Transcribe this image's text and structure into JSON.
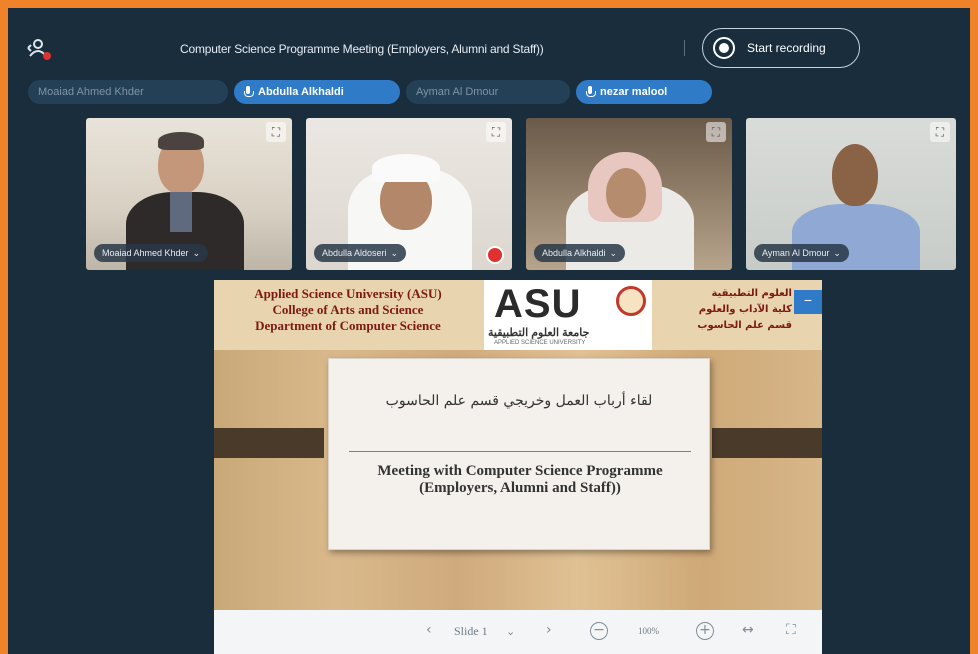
{
  "header": {
    "title": "Computer Science Programme Meeting (Employers, Alumni and Staff))",
    "record_label": "Start recording"
  },
  "participants_bar": [
    {
      "name": "Moaiad Ahmed Khder",
      "speaking": false
    },
    {
      "name": "Abdulla Alkhaldi",
      "speaking": true
    },
    {
      "name": "Ayman Al Dmour",
      "speaking": false
    },
    {
      "name": "nezar malool",
      "speaking": true
    }
  ],
  "video_tiles": [
    {
      "name": "Moaiad Ahmed Khder",
      "muted": false
    },
    {
      "name": "Abdulla Aldoseri",
      "muted": true
    },
    {
      "name": "Abdulla Alkhaldi",
      "muted": false
    },
    {
      "name": "Ayman Al Dmour",
      "muted": false
    }
  ],
  "slide": {
    "header_en": [
      "Applied Science University (ASU)",
      "College of Arts and Science",
      "Department of Computer Science"
    ],
    "logo_text": "ASU",
    "logo_ar": "جامعة العلوم التطبيقية",
    "logo_sub": "APPLIED SCIENCE UNIVERSITY",
    "header_ar": [
      "العلوم التطبيقية",
      "كلية الآداب والعلوم",
      "قسم علم الحاسوب"
    ],
    "title_ar": "لقاء أرباب العمل وخريجي قسم علم الحاسوب",
    "title_en": "Meeting with Computer Science Programme (Employers, Alumni and Staff))"
  },
  "toolbar": {
    "slide_label": "Slide 1",
    "zoom": "100%"
  }
}
